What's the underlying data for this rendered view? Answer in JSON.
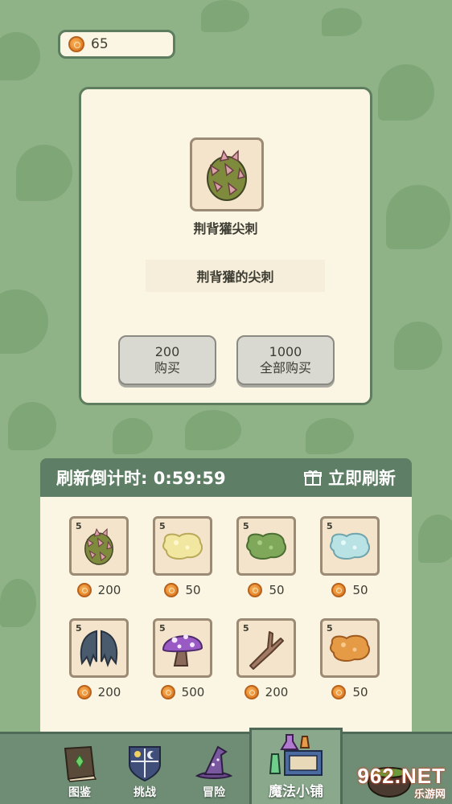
{
  "currency": {
    "amount": "65",
    "icon": "coin-icon"
  },
  "detail": {
    "name": "荆背獾尖刺",
    "description": "荆背獾的尖刺",
    "buy_one": {
      "price": "200",
      "label": "购买"
    },
    "buy_all": {
      "price": "1000",
      "label": "全部购买"
    }
  },
  "shop": {
    "countdown_label": "刷新倒计时: 0:59:59",
    "refresh_label": "立即刷新",
    "items": [
      {
        "count": "5",
        "price": "200",
        "icon": "thorn-spike-icon"
      },
      {
        "count": "5",
        "price": "50",
        "icon": "yellow-slime-icon"
      },
      {
        "count": "5",
        "price": "50",
        "icon": "green-slime-icon"
      },
      {
        "count": "5",
        "price": "50",
        "icon": "blue-slime-icon"
      },
      {
        "count": "5",
        "price": "200",
        "icon": "bat-wings-icon"
      },
      {
        "count": "5",
        "price": "500",
        "icon": "purple-mushroom-icon"
      },
      {
        "count": "5",
        "price": "200",
        "icon": "branch-icon"
      },
      {
        "count": "5",
        "price": "50",
        "icon": "orange-slime-icon"
      }
    ]
  },
  "nav": {
    "tabs": [
      {
        "label": "图鉴",
        "icon": "book-icon"
      },
      {
        "label": "挑战",
        "icon": "shield-icon"
      },
      {
        "label": "冒险",
        "icon": "witch-hat-icon"
      },
      {
        "label": "魔法小铺",
        "icon": "potion-shop-icon",
        "active": true
      }
    ]
  },
  "watermark": {
    "main": "962.NET",
    "sub": "乐游网"
  },
  "colors": {
    "background": "#8fb287",
    "panel": "#fbf5e4",
    "header": "#5e7f66",
    "coin": "#e8892f"
  }
}
